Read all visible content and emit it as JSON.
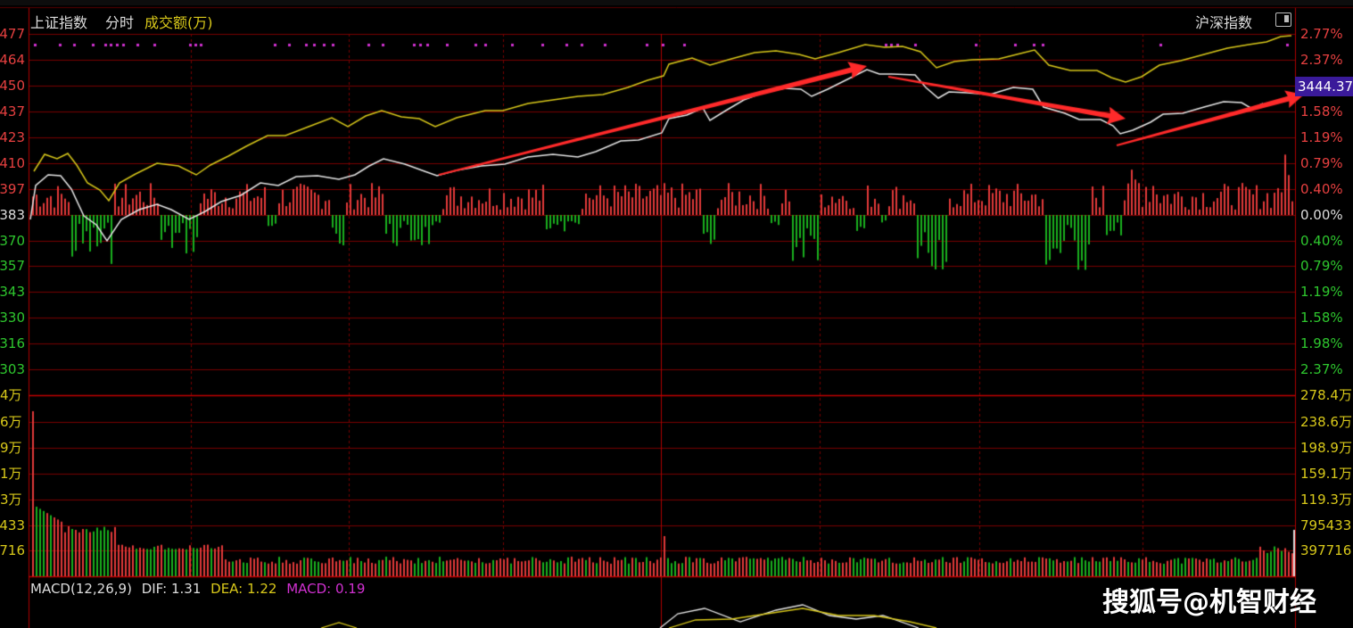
{
  "header": {
    "index_name": "上证指数",
    "mode": "分时",
    "volume_label": "成交额(万)",
    "compare_label": "沪深指数"
  },
  "price_axis_left": [
    "477",
    "464",
    "450",
    "437",
    "423",
    "410",
    "397",
    "383",
    "370",
    "357",
    "343",
    "330",
    "316",
    "303"
  ],
  "price_axis_right": [
    "2.77%",
    "2.37%",
    "1.98%",
    "1.58%",
    "1.19%",
    "0.79%",
    "0.40%",
    "0.00%",
    "0.40%",
    "0.79%",
    "1.19%",
    "1.58%",
    "1.98%",
    "2.37%"
  ],
  "volume_axis_left": [
    "4万",
    "6万",
    "9万",
    "1万",
    "3万",
    "433",
    "716"
  ],
  "volume_axis_right": [
    "278.4万",
    "238.6万",
    "198.9万",
    "159.1万",
    "119.3万",
    "795433",
    "397716"
  ],
  "current_price": "3444.37",
  "macd": {
    "name": "MACD(12,26,9)",
    "dif_label": "DIF: 1.31",
    "dea_label": "DEA: 1.22",
    "macd_label": "MACD: 0.19"
  },
  "watermark": "搜狐号@机智财经",
  "colors": {
    "grid": "#7a0000",
    "white_line": "#e6e6e6",
    "yellow_line": "#d8c81a",
    "up": "#e33a3a",
    "down": "#19b01e",
    "arrow": "#ff2a2a",
    "dots": "#d030d0",
    "axis_red": "#e64040",
    "axis_green": "#2ec62e",
    "axis_white": "#dddddd"
  }
}
